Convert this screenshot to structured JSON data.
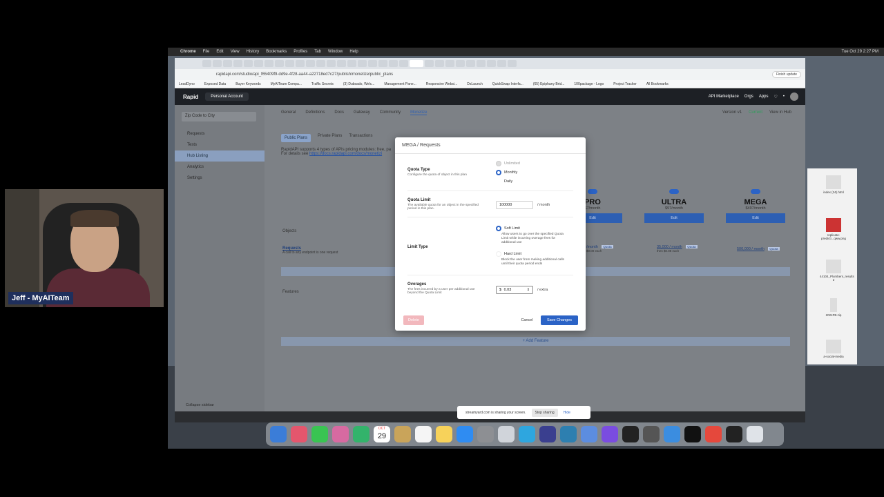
{
  "menubar": {
    "items": [
      "Chrome",
      "File",
      "Edit",
      "View",
      "History",
      "Bookmarks",
      "Profiles",
      "Tab",
      "Window",
      "Help"
    ],
    "clock": "Tue Oct 29  2:27 PM"
  },
  "browser": {
    "url": "rapidapi.com/studio/api_f65409f9-dd9e-4f28-aa44-a22718ed7c27/publish/monetize/public_plans",
    "finish_update": "Finish update",
    "bookmarks": [
      "LeadDyno",
      "Exposed Data",
      "Buyer Keywords",
      "MyAITeam Compa...",
      "Traffic Secrets",
      "(3) Dubsado, Welc...",
      "Management Pane...",
      "Responsive Websi...",
      "DsLaunch",
      "QuickSwap Interfa...",
      "(65) Epiphany Brid...",
      "100package - Logo",
      "Project Tracker",
      "All Bookmarks"
    ]
  },
  "app": {
    "logo": "Rapid",
    "account": "Personal Account",
    "top_links": [
      "API Marketplace",
      "Orgs",
      "Apps"
    ],
    "api_select": "Zip Code to City",
    "sidebar": [
      {
        "label": "Requests",
        "active": false
      },
      {
        "label": "Tests",
        "active": false
      },
      {
        "label": "Hub Listing",
        "active": true
      },
      {
        "label": "Analytics",
        "active": false
      },
      {
        "label": "Settings",
        "active": false
      }
    ],
    "collapse": "Collapse sidebar",
    "subnav": [
      "General",
      "Definitions",
      "Docs",
      "Gateway",
      "Community",
      "Monetize"
    ],
    "version": "Version v1",
    "version_badge": "Current",
    "view_in_hub": "View in Hub",
    "plan_tabs": [
      "Public Plans",
      "Private Plans",
      "Transactions"
    ],
    "info_line1": "RapidAPI supports 4 types of APIs pricing modules: free, pa",
    "info_line2_prefix": "For details see ",
    "info_link": "https://docs.rapidapi.com/docs/monetizi",
    "plans": [
      {
        "name": "PRO",
        "price": "$7/month",
        "edit": "Edit"
      },
      {
        "name": "ULTRA",
        "price": "$97/month",
        "edit": "Edit"
      },
      {
        "name": "MEGA",
        "price": "$497/month",
        "edit": "Edit"
      }
    ],
    "objects_label": "Objects",
    "requests_title": "Requests",
    "requests_desc": "A call to any endpoint is one request",
    "quotas": [
      "/month",
      "35,000 / month",
      "500,000 / month"
    ],
    "quota_sub": [
      "$0.00 each",
      "then $0.08 each",
      ""
    ],
    "quota_badge": "Quota",
    "features_label": "Features",
    "add_feature": "+ Add Feature"
  },
  "modal": {
    "title": "MEGA / Requests",
    "quota_type": {
      "label": "Quota Type",
      "desc": "Configure the quota of object in this plan",
      "options": [
        "Unlimited",
        "Monthly",
        "Daily"
      ],
      "selected": "Monthly"
    },
    "quota_limit": {
      "label": "Quota Limit",
      "desc": "The available quota for an object in the specified period in this plan.",
      "value": "100000",
      "unit": "/ month"
    },
    "limit_type": {
      "label": "Limit Type",
      "soft": "Soft Limit",
      "soft_desc": "Allow users to go over the specified Quota Limit while incurring overage fees for additional use",
      "hard": "Hard Limit",
      "hard_desc": "Block the user from making additional calls until their quota period ends",
      "selected": "Soft Limit"
    },
    "overages": {
      "label": "Overages",
      "desc": "The fees incurred by a user per additional use beyond the Quota Limit",
      "currency": "$",
      "value": "0.03",
      "unit": "/ extra"
    },
    "delete": "Delete",
    "cancel": "Cancel",
    "save": "Save Changes"
  },
  "share_bar": {
    "text": "streamyard.com is sharing your screen.",
    "stop": "Stop sharing",
    "hide": "Hide"
  },
  "webcam": {
    "name": "Jeff - MyAITeam"
  },
  "files": [
    "index (24).html",
    "replicate-predicti...qww.png",
    "44104_Plumbers_results 2",
    "2024FB.zip",
    "a-social-media"
  ],
  "calendar": {
    "month": "OCT",
    "day": "29"
  },
  "colors": {
    "accent": "#2b63c6",
    "delete": "#f2b8bd",
    "badge": "#2e9e5b"
  }
}
